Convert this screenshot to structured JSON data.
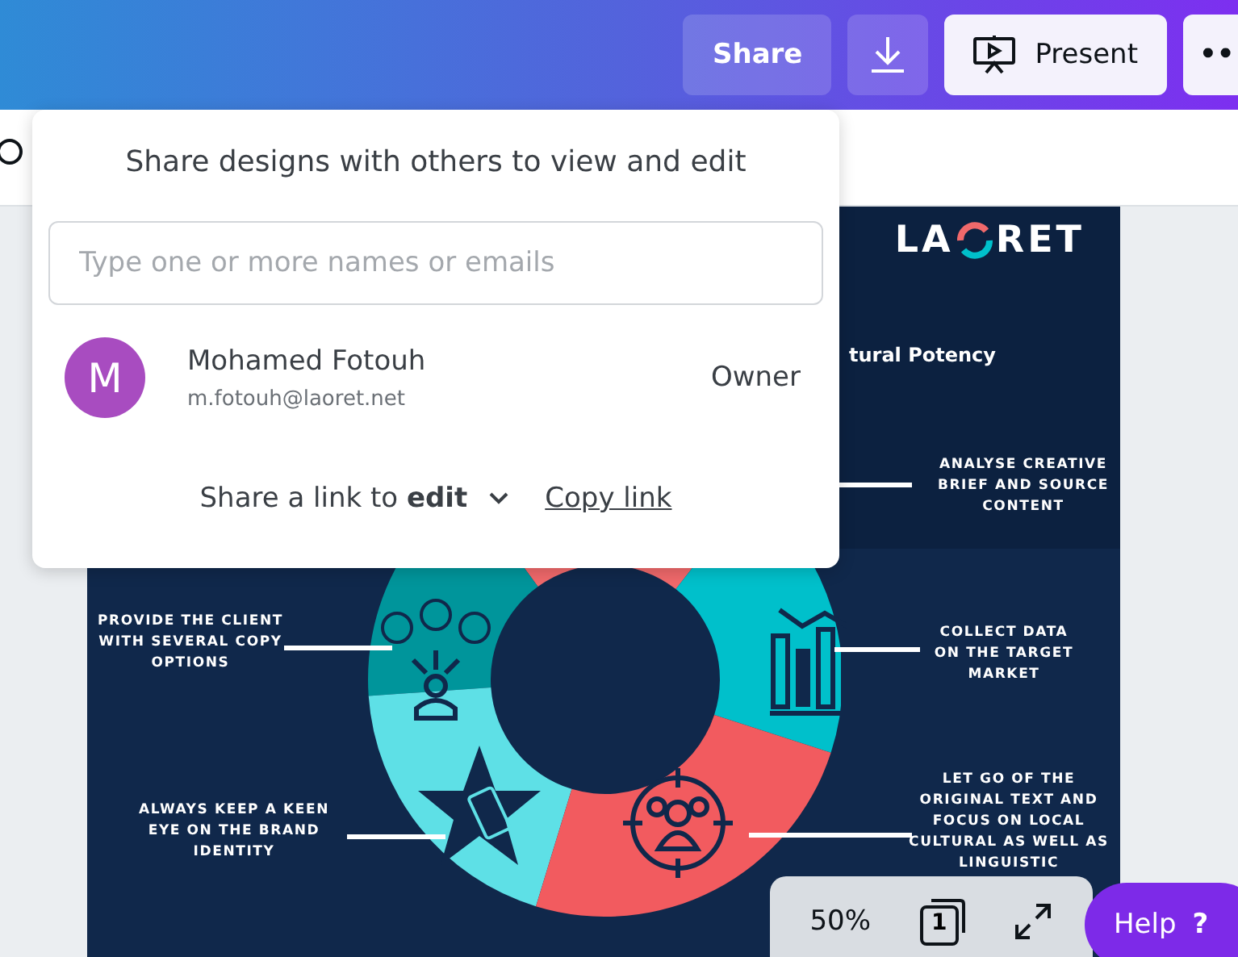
{
  "header": {
    "share": "Share",
    "present": "Present",
    "more": "••"
  },
  "share_popover": {
    "title": "Share designs with others to view and edit",
    "input": {
      "placeholder": "Type one or more names or emails"
    },
    "members": [
      {
        "initial": "M",
        "name": "Mohamed Fotouh",
        "email": "m.fotouh@laoret.net",
        "role": "Owner",
        "color": "#a84cc0"
      }
    ],
    "link_text": "Share a link to **edit**",
    "copy_link": "Copy link"
  },
  "design": {
    "logo_left": "LA",
    "logo_right": "RET",
    "title": "tural Potency",
    "steps": [
      {
        "kind": "analyse",
        "label": "ANALYSE CREATIVE BRIEF AND SOURCE CONTENT",
        "color": "#f0696b"
      },
      {
        "kind": "faces",
        "label": "PROVIDE THE CLIENT WITH SEVERAL COPY OPTIONS",
        "color": "#00959b"
      },
      {
        "kind": "chart",
        "label": "COLLECT DATA ON THE TARGET MARKET",
        "color": "#00c0cb"
      },
      {
        "kind": "star",
        "label": "ALWAYS KEEP A KEEN EYE ON THE BRAND IDENTITY",
        "color": "#5ee0e6"
      },
      {
        "kind": "group",
        "label": "LET GO OF THE ORIGINAL TEXT AND FOCUS ON LOCAL CULTURAL AS WELL AS LINGUISTIC",
        "color": "#f25b5f"
      }
    ]
  },
  "zoom": {
    "level": "50%",
    "page": "1"
  },
  "help": {
    "label": "Help",
    "mark": "?"
  }
}
